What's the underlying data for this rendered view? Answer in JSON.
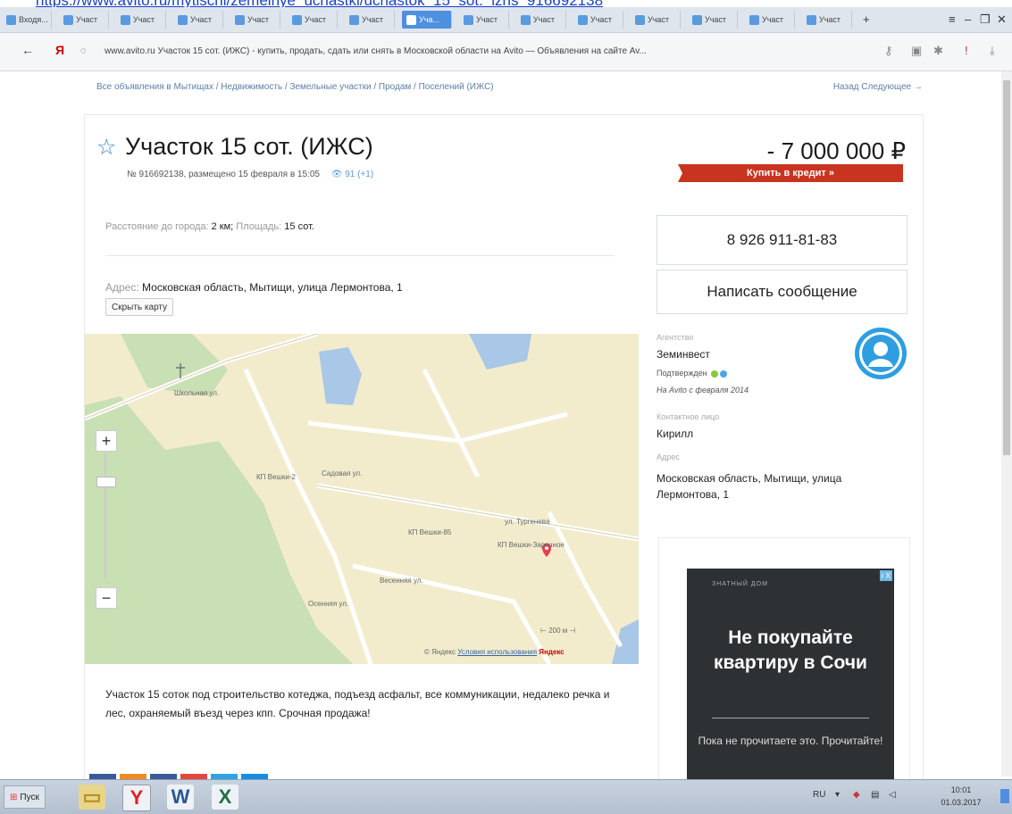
{
  "browser": {
    "top_url_fragment": "https://www.avito.ru/mytischi/zemelnye_uchastki/uchastok_15_sot._izhs_916692138",
    "tabs": [
      "Входя...",
      "Участ",
      "Участ",
      "Участ",
      "Участ",
      "Участ",
      "Участ",
      "Уча...",
      "Участ",
      "Участ",
      "Участ",
      "Участ",
      "Участ",
      "Участ",
      "Участ"
    ],
    "active_tab_index": 7,
    "new_tab": "+",
    "address": "www.avito.ru  Участок 15 сот. (ИЖС) - купить, продать, сдать или снять в Московской области на Avito — Объявления на сайте Av..."
  },
  "page": {
    "breadcrumbs": "Все объявления в Мытищах / Недвижимость / Земельные участки / Продам / Поселений (ИЖС)",
    "nav_links": "Назад  Следующее →",
    "title": "Участок 15 сот. (ИЖС)",
    "meta": "№ 916692138, размещено 15 февраля в 15:05",
    "views": "91 (+1)",
    "price": "7 000 000 ₽",
    "credit_button": "Купить в кредит »",
    "params": {
      "distance_label": "Расстояние до города:",
      "distance_value": "2 км;",
      "area_label": "Площадь:",
      "area_value": "15 сот."
    },
    "address_label": "Адрес:",
    "address_value": "Московская область, Мытищи, улица Лермонтова, 1",
    "hide_map_button": "Скрыть карту",
    "description": "Участок 15 соток под строительство котеджа, подъезд асфальт, все коммуникации, недалеко речка и лес, охраняемый въезд через кпп. Срочная продажа!"
  },
  "map": {
    "zoom_in": "+",
    "zoom_out": "−",
    "labels": [
      "КП Вешки-2",
      "Садовая ул.",
      "КП Вешки-85",
      "КП Вешки-Заречное",
      "Весенняя ул.",
      "Осенняя ул.",
      "Школьная ул.",
      "ул. Тургенева"
    ],
    "scale": "200 м",
    "copyright": "© Яндекс",
    "terms_link": "Условия использования",
    "logo": "Яндекс"
  },
  "sidebar": {
    "phone": "8 926 911-81-83",
    "write_message": "Написать сообщение",
    "agency_label": "Агентство",
    "agency_value": "Земинвест",
    "verified": "Подтвержден",
    "since": "На Avito с февраля 2014",
    "contact_label": "Контактное лицо",
    "contact_value": "Кирилл",
    "address_label": "Адрес",
    "address_value": "Московская область, Мытищи, улица Лермонтова, 1"
  },
  "ad": {
    "brand": "ЗНАТНЫЙ ДОМ",
    "headline": "Не покупайте квартиру в Сочи",
    "subtext": "Пока не прочитаете это. Прочитайте!",
    "close": "i X"
  },
  "taskbar": {
    "start": "Пуск",
    "lang": "RU",
    "time": "10:01",
    "date": "01.03.2017"
  },
  "colors": {
    "link": "#5b7fa8",
    "credit": "#c8341f",
    "star": "#3f87d6",
    "avatar": "#2f9ee0",
    "map_bg": "#f2eccd",
    "forest": "#c9dfb4",
    "water": "#a9c7e6"
  }
}
